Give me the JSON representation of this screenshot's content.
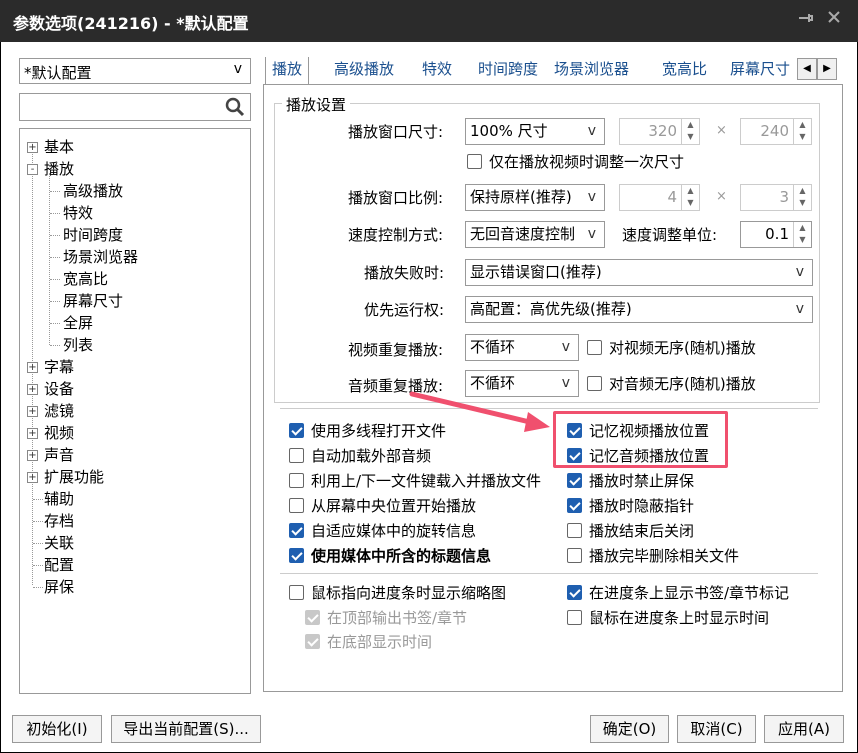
{
  "window": {
    "title": "参数选项(241216) - *默认配置",
    "pin_icon": "pin-icon",
    "close_icon": "close-icon"
  },
  "left": {
    "profile": "*默认配置",
    "search_placeholder": "",
    "tree": [
      {
        "label": "基本",
        "expander": "+"
      },
      {
        "label": "播放",
        "expander": "-"
      },
      {
        "label": "高级播放"
      },
      {
        "label": "特效"
      },
      {
        "label": "时间跨度"
      },
      {
        "label": "场景浏览器"
      },
      {
        "label": "宽高比"
      },
      {
        "label": "屏幕尺寸"
      },
      {
        "label": "全屏"
      },
      {
        "label": "列表"
      },
      {
        "label": "字幕",
        "expander": "+"
      },
      {
        "label": "设备",
        "expander": "+"
      },
      {
        "label": "滤镜",
        "expander": "+"
      },
      {
        "label": "视频",
        "expander": "+"
      },
      {
        "label": "声音",
        "expander": "+"
      },
      {
        "label": "扩展功能",
        "expander": "+"
      },
      {
        "label": "辅助"
      },
      {
        "label": "存档"
      },
      {
        "label": "关联"
      },
      {
        "label": "配置"
      },
      {
        "label": "屏保"
      }
    ]
  },
  "tabs": [
    "播放",
    "高级播放",
    "特效",
    "时间跨度",
    "场景浏览器",
    "宽高比",
    "屏幕尺寸"
  ],
  "playback_group": {
    "title": "播放设置",
    "window_size_label": "播放窗口尺寸:",
    "window_size_value": "100% 尺寸",
    "width_value": "320",
    "height_value": "240",
    "times": "×",
    "adjust_once_label": "仅在播放视频时调整一次尺寸",
    "ratio_label": "播放窗口比例:",
    "ratio_value": "保持原样(推荐)",
    "ratio_w": "4",
    "ratio_h": "3",
    "speed_mode_label": "速度控制方式:",
    "speed_mode_value": "无回音速度控制",
    "speed_unit_label": "速度调整单位:",
    "speed_unit_value": "0.1",
    "fail_label": "播放失败时:",
    "fail_value": "显示错误窗口(推荐)",
    "priority_label": "优先运行权:",
    "priority_value": "高配置：高优先级(推荐)",
    "video_repeat_label": "视频重复播放:",
    "video_repeat_value": "不循环",
    "video_shuffle_label": "对视频无序(随机)播放",
    "audio_repeat_label": "音频重复播放:",
    "audio_repeat_value": "不循环",
    "audio_shuffle_label": "对音频无序(随机)播放"
  },
  "options_left": [
    {
      "label": "使用多线程打开文件",
      "checked": true
    },
    {
      "label": "自动加载外部音频",
      "checked": false
    },
    {
      "label": "利用上/下一文件键载入并播放文件",
      "checked": false
    },
    {
      "label": "从屏幕中央位置开始播放",
      "checked": false
    },
    {
      "label": "自适应媒体中的旋转信息",
      "checked": true
    },
    {
      "label": "使用媒体中所含的标题信息",
      "checked": true
    }
  ],
  "options_right": [
    {
      "label": "记忆视频播放位置",
      "checked": true
    },
    {
      "label": "记忆音频播放位置",
      "checked": true
    },
    {
      "label": "播放时禁止屏保",
      "checked": true
    },
    {
      "label": "播放时隐蔽指针",
      "checked": true
    },
    {
      "label": "播放结束后关闭",
      "checked": false
    },
    {
      "label": "播放完毕删除相关文件",
      "checked": false
    }
  ],
  "seek_options": {
    "thumbnail_label": "鼠标指向进度条时显示缩略图",
    "bookmark_top_label": "在顶部输出书签/章节",
    "time_bottom_label": "在底部显示时间",
    "chapter_marks_label": "在进度条上显示书签/章节标记",
    "hover_time_label": "鼠标在进度条上时显示时间"
  },
  "buttons": {
    "init": "初始化(I)",
    "export": "导出当前配置(S)...",
    "ok": "确定(O)",
    "cancel": "取消(C)",
    "apply": "应用(A)"
  },
  "colors": {
    "accent": "#1f5fb0",
    "highlight": "#f0506e",
    "titlebar": "#2b2b2b"
  }
}
